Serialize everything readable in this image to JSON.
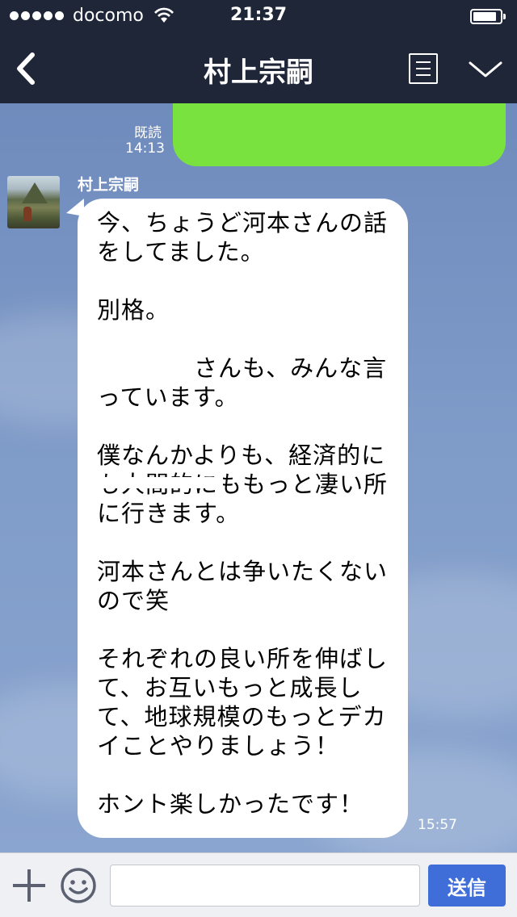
{
  "status_bar": {
    "carrier": "docomo",
    "time": "21:37"
  },
  "header": {
    "title": "村上宗嗣",
    "back_icon": "chevron-left-icon",
    "menu_icon": "list-icon",
    "collapse_icon": "chevron-down-icon"
  },
  "messages": {
    "sent": {
      "read_label": "既読",
      "time": "14:13",
      "color": "#79e23f"
    },
    "received": {
      "sender": "村上宗嗣",
      "text": "今、ちょうど河本さんの話をしてました。\n\n別格。\n\n　　　　さんも、みんな言っています。\n\n僕なんかよりも、経済的にも人間的にももっと凄い所に行きます。\n\n河本さんとは争いたくないので笑\n\nそれぞれの良い所を伸ばして、お互いもっと成長して、地球規模のもっとデカイことやりましょう！\n\nホント楽しかったです！",
      "time": "15:57"
    }
  },
  "input_bar": {
    "add_icon": "plus-icon",
    "emoji_icon": "smiley-icon",
    "placeholder": "",
    "send_label": "送信",
    "send_color": "#3f6ed8"
  }
}
